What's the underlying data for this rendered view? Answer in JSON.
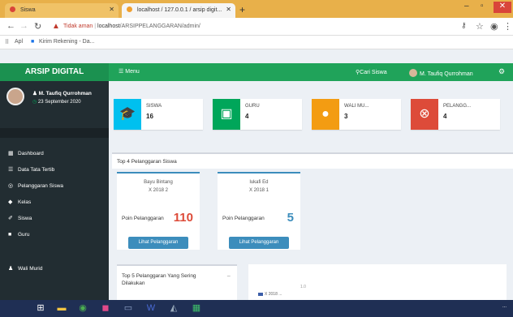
{
  "browser": {
    "tab1_label": "Siswa",
    "tab2_label": "localhost / 127.0.0.1 / arsip digit...",
    "new_tab_symbol": "+",
    "warning_label": "Tidak aman",
    "url_host": "localhost",
    "url_path": "/ARSIPPELANGGARAN/admin/",
    "bookmarks": [
      "Apl",
      "Kirim Rekening - Da..."
    ]
  },
  "app": {
    "brand": "ARSIP DIGITAL",
    "menu_label": "Menu",
    "search_label": "Cari Siswa",
    "user_name_top": "M. Taufiq Qurrohman"
  },
  "sidebar": {
    "user_name": "M. Taufiq Qurrohman",
    "user_date": "23 September 2020",
    "items": [
      {
        "label": "Dashboard",
        "icon": "dashboard-icon",
        "glyph": "▦"
      },
      {
        "label": "Data Tata Tertib",
        "icon": "list-icon",
        "glyph": "☰"
      },
      {
        "label": "Pelanggaran Siswa",
        "icon": "gauge-icon",
        "glyph": "◎"
      },
      {
        "label": "Kelas",
        "icon": "tag-icon",
        "glyph": "◆"
      },
      {
        "label": "Siswa",
        "icon": "pin-icon",
        "glyph": "✐"
      },
      {
        "label": "Guru",
        "icon": "briefcase-icon",
        "glyph": "■"
      },
      {
        "label": "Wali Murid",
        "icon": "user-icon",
        "glyph": "♟"
      }
    ]
  },
  "stats": [
    {
      "label": "SISWA",
      "value": "16",
      "color": "#00c0ef",
      "icon": "graduation-cap-icon",
      "glyph": "🎓"
    },
    {
      "label": "GURU",
      "value": "4",
      "color": "#00a65a",
      "icon": "teacher-board-icon",
      "glyph": "▣"
    },
    {
      "label": "WALI MU...",
      "value": "3",
      "color": "#f39c12",
      "icon": "user-icon",
      "glyph": "●"
    },
    {
      "label": "PELANGG...",
      "value": "4",
      "color": "#dd4b39",
      "icon": "close-circle-icon",
      "glyph": "⊗"
    }
  ],
  "top_violations": {
    "title": "Top 4 Pelanggaran Siswa",
    "points_label": "Poin Pelanggaran",
    "button_label": "Lihat Pelanggaran",
    "cards": [
      {
        "name": "Bayu Bintang",
        "class": "X 2018 2",
        "points": "110",
        "points_color": "#dd4b39"
      },
      {
        "name": "lukafi Ed",
        "class": "X 2018 1",
        "points": "5",
        "points_color": "#3c8dbc"
      }
    ]
  },
  "bottom": {
    "frequent_title": "Top 5 Pelanggaran Yang Sering Dilakukan",
    "collapse_symbol": "−",
    "chart_tick": "1.0",
    "chart_legend": "X 2018 ..."
  },
  "taskbar": {
    "tray_text": "..."
  }
}
